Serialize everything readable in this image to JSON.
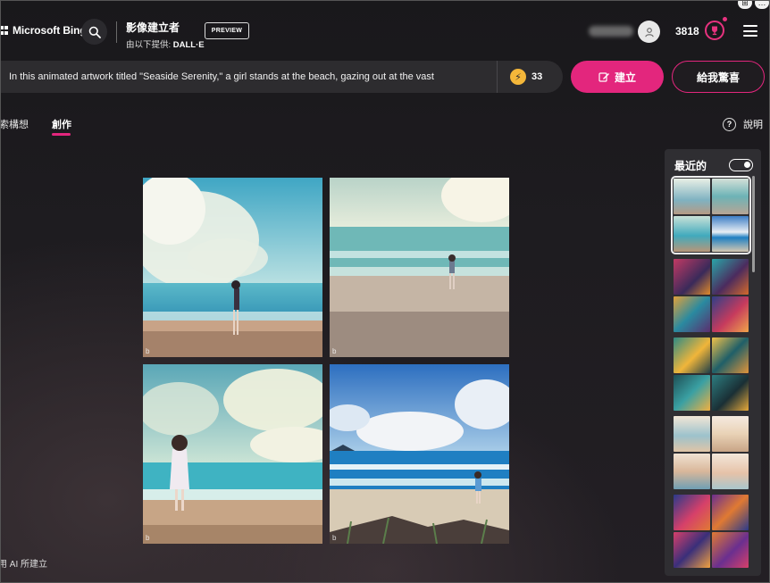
{
  "header": {
    "brand": "Microsoft Bing",
    "app_title": "影像建立者",
    "provider_prefix": "由以下提供:",
    "provider_name": "DALL·E",
    "preview_badge": "PREVIEW",
    "points": "3818",
    "window_controls": [
      "⊞",
      "…"
    ]
  },
  "prompt": {
    "text": "In this animated artwork titled \"Seaside Serenity,\" a girl stands at the beach, gazing out at the vast",
    "boosts": "33",
    "create_label": "建立",
    "surprise_label": "給我驚喜"
  },
  "tabs": {
    "explore": "探索構想",
    "create": "創作"
  },
  "help_label": "說明",
  "footer_note": "使用 AI 所建立",
  "results": {
    "watermark": "b",
    "tiles": [
      "result-1",
      "result-2",
      "result-3",
      "result-4"
    ]
  },
  "recent": {
    "title": "最近的",
    "toggle_on": true,
    "thumbs": [
      {
        "colors": [
          "#cfd8d3",
          "#7fa8b8",
          "#8fc3d4",
          "#5aa3cf"
        ]
      },
      {
        "colors": [
          "#c23a64",
          "#4b2b5e",
          "#2aa6a8",
          "#d46a2b"
        ]
      },
      {
        "colors": [
          "#2e8a85",
          "#f0b53a",
          "#1f5f68",
          "#e0943a"
        ]
      },
      {
        "colors": [
          "#d9b79a",
          "#e9d2b6",
          "#9cc2cc",
          "#e6c2a8"
        ]
      },
      {
        "colors": [
          "#2b3a8a",
          "#d6406a",
          "#e07a33",
          "#6a2f8f"
        ]
      }
    ]
  }
}
